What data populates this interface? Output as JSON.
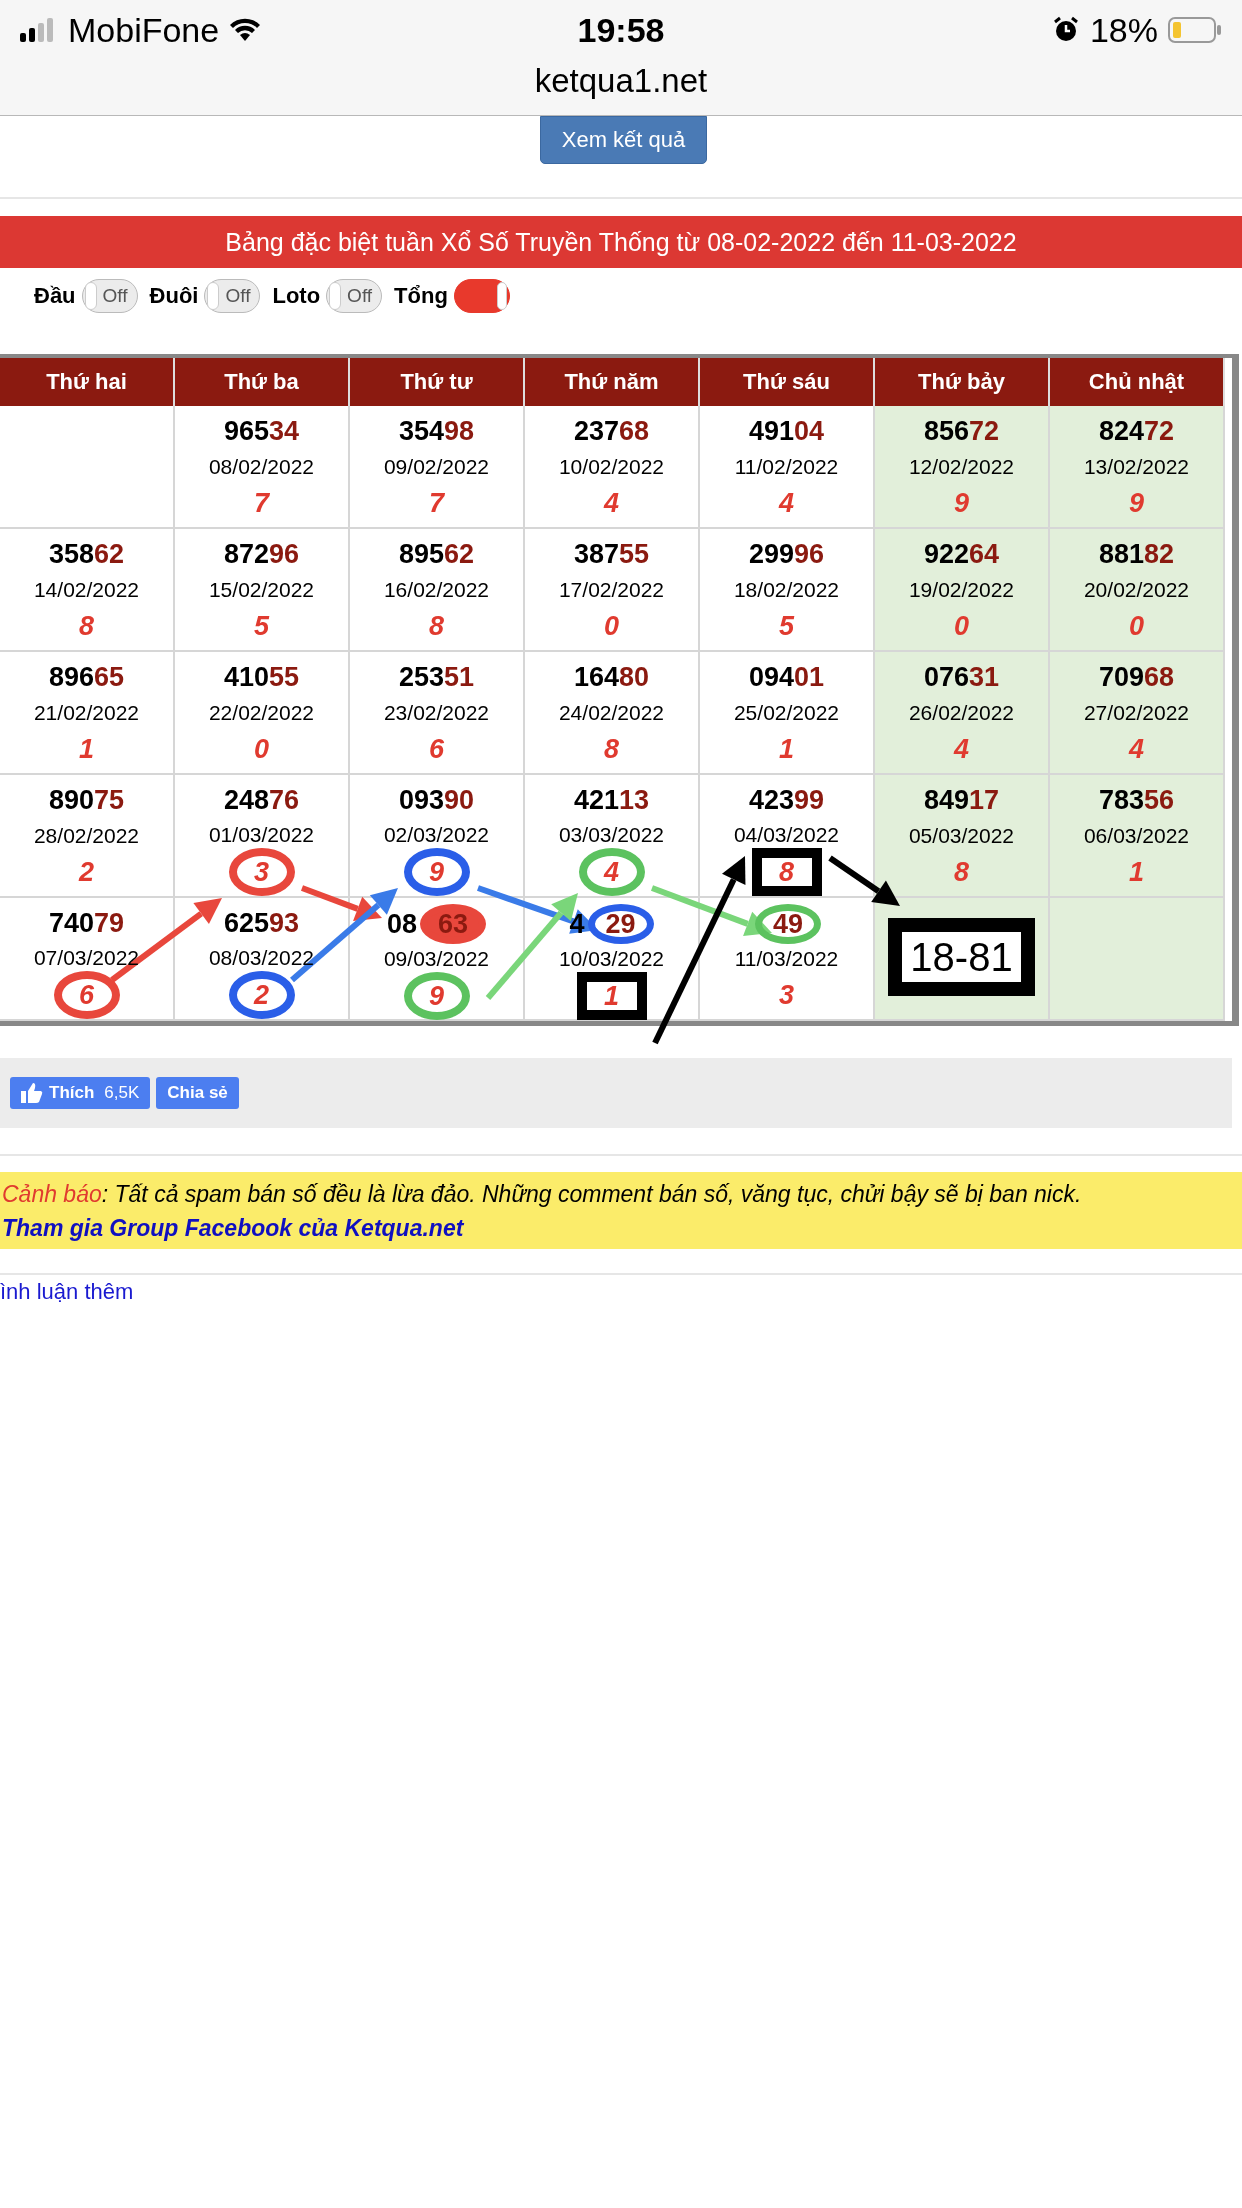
{
  "status_bar": {
    "carrier": "MobiFone",
    "time": "19:58",
    "battery": "18%"
  },
  "address_bar": {
    "url": "ketqua1.net"
  },
  "submit_button": "Xem kết quả",
  "banner": "Bảng đặc biệt tuần Xổ Số Truyền Thống từ 08-02-2022 đến 11-03-2022",
  "toggles": [
    {
      "label": "Đầu",
      "on": false,
      "text": "Off"
    },
    {
      "label": "Đuôi",
      "on": false,
      "text": "Off"
    },
    {
      "label": "Loto",
      "on": false,
      "text": "Off"
    },
    {
      "label": "Tổng",
      "on": true
    }
  ],
  "table": {
    "columns": [
      {
        "label": "Thứ hai",
        "weekend": false
      },
      {
        "label": "Thứ ba",
        "weekend": false
      },
      {
        "label": "Thứ tư",
        "weekend": false
      },
      {
        "label": "Thứ năm",
        "weekend": false
      },
      {
        "label": "Thứ sáu",
        "weekend": false
      },
      {
        "label": "Thứ bảy",
        "weekend": true
      },
      {
        "label": "Chủ nhật",
        "weekend": true
      }
    ],
    "rows": [
      [
        null,
        {
          "head": "965",
          "tail": "34",
          "date": "08/02/2022",
          "sum": "7"
        },
        {
          "head": "354",
          "tail": "98",
          "date": "09/02/2022",
          "sum": "7"
        },
        {
          "head": "237",
          "tail": "68",
          "date": "10/02/2022",
          "sum": "4"
        },
        {
          "head": "491",
          "tail": "04",
          "date": "11/02/2022",
          "sum": "4"
        },
        {
          "head": "856",
          "tail": "72",
          "date": "12/02/2022",
          "sum": "9"
        },
        {
          "head": "824",
          "tail": "72",
          "date": "13/02/2022",
          "sum": "9"
        }
      ],
      [
        {
          "head": "358",
          "tail": "62",
          "date": "14/02/2022",
          "sum": "8"
        },
        {
          "head": "872",
          "tail": "96",
          "date": "15/02/2022",
          "sum": "5"
        },
        {
          "head": "895",
          "tail": "62",
          "date": "16/02/2022",
          "sum": "8"
        },
        {
          "head": "387",
          "tail": "55",
          "date": "17/02/2022",
          "sum": "0"
        },
        {
          "head": "299",
          "tail": "96",
          "date": "18/02/2022",
          "sum": "5"
        },
        {
          "head": "922",
          "tail": "64",
          "date": "19/02/2022",
          "sum": "0"
        },
        {
          "head": "881",
          "tail": "82",
          "date": "20/02/2022",
          "sum": "0"
        }
      ],
      [
        {
          "head": "896",
          "tail": "65",
          "date": "21/02/2022",
          "sum": "1"
        },
        {
          "head": "410",
          "tail": "55",
          "date": "22/02/2022",
          "sum": "0"
        },
        {
          "head": "253",
          "tail": "51",
          "date": "23/02/2022",
          "sum": "6"
        },
        {
          "head": "164",
          "tail": "80",
          "date": "24/02/2022",
          "sum": "8"
        },
        {
          "head": "094",
          "tail": "01",
          "date": "25/02/2022",
          "sum": "1"
        },
        {
          "head": "076",
          "tail": "31",
          "date": "26/02/2022",
          "sum": "4"
        },
        {
          "head": "709",
          "tail": "68",
          "date": "27/02/2022",
          "sum": "4"
        }
      ],
      [
        {
          "head": "890",
          "tail": "75",
          "date": "28/02/2022",
          "sum": "2"
        },
        {
          "head": "248",
          "tail": "76",
          "date": "01/03/2022",
          "sum": "3",
          "sum_mark": {
            "kind": "ring",
            "color": "#e8473c"
          }
        },
        {
          "head": "093",
          "tail": "90",
          "date": "02/03/2022",
          "sum": "9",
          "sum_mark": {
            "kind": "ring",
            "color": "#2a5ee8"
          }
        },
        {
          "head": "421",
          "tail": "13",
          "date": "03/03/2022",
          "sum": "4",
          "sum_mark": {
            "kind": "ring",
            "color": "#5cc25f"
          }
        },
        {
          "head": "423",
          "tail": "99",
          "date": "04/03/2022",
          "sum": "8",
          "sum_mark": {
            "kind": "box",
            "color": "#000000"
          }
        },
        {
          "head": "849",
          "tail": "17",
          "date": "05/03/2022",
          "sum": "8"
        },
        {
          "head": "783",
          "tail": "56",
          "date": "06/03/2022",
          "sum": "1"
        }
      ],
      [
        {
          "head": "740",
          "tail": "79",
          "date": "07/03/2022",
          "sum": "6",
          "sum_mark": {
            "kind": "ring",
            "color": "#e8473c"
          }
        },
        {
          "head": "625",
          "tail": "93",
          "date": "08/03/2022",
          "sum": "2",
          "sum_mark": {
            "kind": "ring",
            "color": "#2a5ee8"
          }
        },
        {
          "head": "08",
          "tail": "63",
          "date": "09/03/2022",
          "sum": "9",
          "tail_mark": {
            "kind": "disc",
            "color": "#e8473c"
          },
          "sum_mark": {
            "kind": "ring",
            "color": "#5cc25f"
          }
        },
        {
          "head": "4",
          "tail": "29",
          "date": "10/03/2022",
          "sum": "1",
          "tail_mark": {
            "kind": "ring",
            "color": "#2a5ee8"
          },
          "sum_mark": {
            "kind": "box",
            "color": "#000000"
          }
        },
        {
          "tail": "49",
          "date": "11/03/2022",
          "sum": "3",
          "tail_mark": {
            "kind": "ring",
            "color": "#5cc25f"
          }
        },
        {
          "note": "18-81"
        },
        null
      ]
    ]
  },
  "share": {
    "like": "Thích",
    "like_count": "6,5K",
    "share": "Chia sẻ"
  },
  "notice": {
    "label": "Cảnh báo",
    "text": ": Tất cả spam bán số đều là lừa đảo. Những comment bán số, văng tục, chửi bậy sẽ bị ban nick.",
    "link": "Tham gia Group Facebook của Ketqua.net"
  },
  "more_comments": "ình luận thêm"
}
